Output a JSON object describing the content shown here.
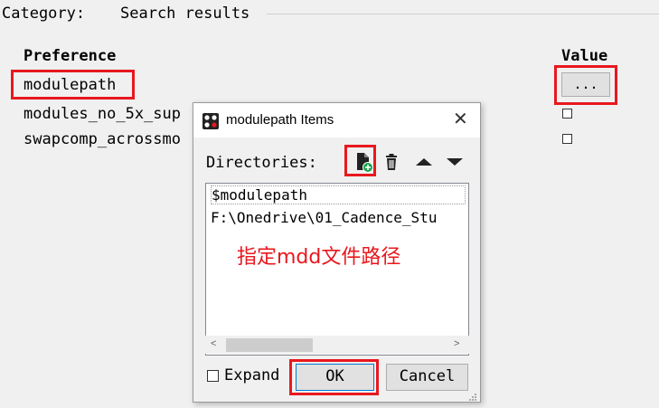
{
  "category": {
    "label": "Category:",
    "value": "Search results"
  },
  "table": {
    "headers": {
      "preference": "Preference",
      "value": "Value"
    },
    "rows": [
      {
        "name": "modulepath",
        "value_kind": "button",
        "button_label": "..."
      },
      {
        "name": "modules_no_5x_sup",
        "value_kind": "checkbox",
        "checked": false
      },
      {
        "name": "swapcomp_acrossmo",
        "value_kind": "checkbox",
        "checked": false
      }
    ]
  },
  "dialog": {
    "title": "modulepath Items",
    "close_glyph": "✕",
    "directories_label": "Directories:",
    "toolbar": [
      {
        "name": "new-file-icon",
        "tooltip": ""
      },
      {
        "name": "trash-icon",
        "tooltip": ""
      },
      {
        "name": "arrow-up-icon",
        "tooltip": ""
      },
      {
        "name": "arrow-down-icon",
        "tooltip": ""
      }
    ],
    "items": [
      "$modulepath",
      "F:\\Onedrive\\01_Cadence_Stu"
    ],
    "annotation": "指定mdd文件路径",
    "scroll_left": "<",
    "scroll_right": ">",
    "expand_label": "Expand",
    "expand_checked": false,
    "ok_label": "OK",
    "cancel_label": "Cancel"
  },
  "colors": {
    "highlight": "#e8181e",
    "add_badge": "#1aa34a",
    "focus_border": "#0078d7"
  }
}
